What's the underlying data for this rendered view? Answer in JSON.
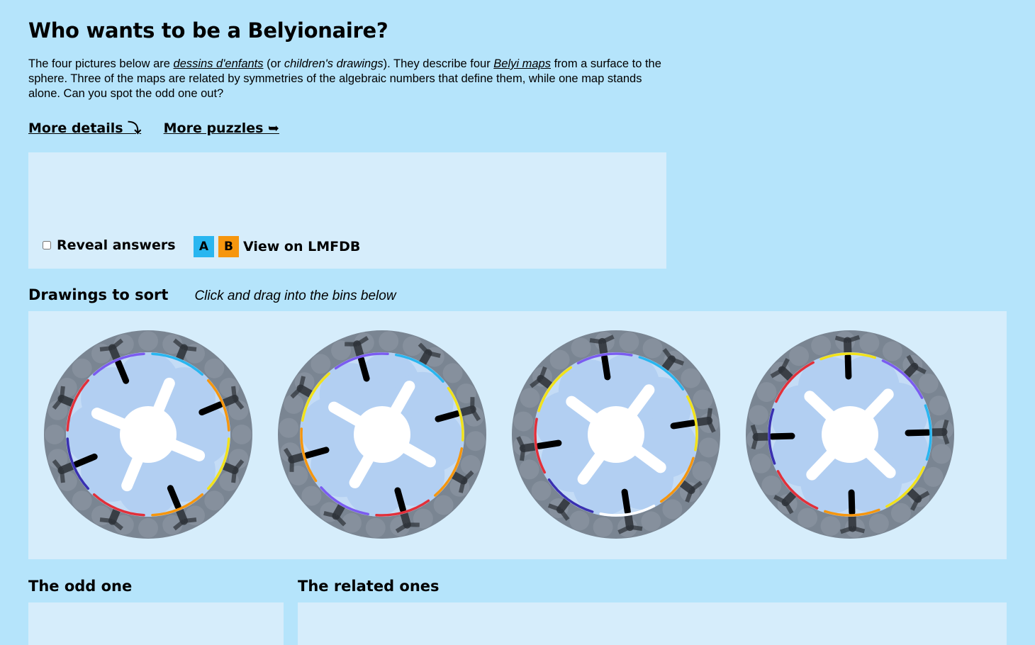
{
  "page": {
    "title": "Who wants to be a Belyionaire?",
    "intro": {
      "t1": "The four pictures below are ",
      "link1": "dessins d'enfants",
      "t2": " (or ",
      "em1": "children's drawings",
      "t3": "). They describe four ",
      "link2": "Belyi maps",
      "t4": " from a surface to the sphere. Three of the maps are related by symmetries of the algebraic numbers that define them, while one map stands alone. Can you spot the odd one out?"
    },
    "links": {
      "more_details": "More details ⤵",
      "more_puzzles": "More puzzles ➥"
    }
  },
  "controls": {
    "reveal_label": "Reveal answers",
    "key_a": "A",
    "key_b": "B",
    "lmfdb_label": "View on LMFDB"
  },
  "sorting": {
    "heading": "Drawings to sort",
    "hint": "Click and drag into the bins below"
  },
  "bins": {
    "odd": "The odd one",
    "related": "The related ones"
  },
  "colors": {
    "page_bg": "#b5e4fb",
    "panel_bg": "#d6edfb",
    "key_a": "#29b6f0",
    "key_b": "#f6960e",
    "edge_colors": [
      "#29b6f0",
      "#7b5cf0",
      "#f6960e",
      "#f2e21a",
      "#e2303a",
      "#3a30b0",
      "#ffffff"
    ]
  },
  "drawings": [
    {
      "icon": "dessin-drawing-1",
      "arcs": [
        "#29b6f0",
        "#f6960e",
        "#f2e21a",
        "#f6960e",
        "#e2303a",
        "#3a30b0",
        "#e2303a",
        "#7b5cf0"
      ]
    },
    {
      "icon": "dessin-drawing-2",
      "arcs": [
        "#29b6f0",
        "#f2e21a",
        "#f6960e",
        "#e2303a",
        "#7b5cf0",
        "#f6960e",
        "#f2e21a",
        "#7b5cf0"
      ]
    },
    {
      "icon": "dessin-drawing-3",
      "arcs": [
        "#29b6f0",
        "#f2e21a",
        "#f6960e",
        "#ffffff",
        "#3a30b0",
        "#e2303a",
        "#f2e21a",
        "#7b5cf0"
      ]
    },
    {
      "icon": "dessin-drawing-4",
      "arcs": [
        "#7b5cf0",
        "#29b6f0",
        "#f2e21a",
        "#f6960e",
        "#e2303a",
        "#3a30b0",
        "#e2303a",
        "#f2e21a"
      ]
    }
  ]
}
